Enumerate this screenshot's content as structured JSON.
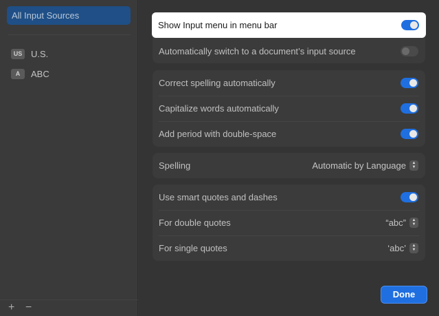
{
  "sidebar": {
    "selected_label": "All Input Sources",
    "sources": [
      {
        "badge": "US",
        "label": "U.S."
      },
      {
        "badge": "A",
        "label": "ABC"
      }
    ],
    "add_label": "+",
    "remove_label": "−"
  },
  "settings": {
    "show_input_menu": {
      "label": "Show Input menu in menu bar",
      "on": true
    },
    "auto_switch": {
      "label": "Automatically switch to a document’s input source",
      "on": false
    },
    "correct_spelling": {
      "label": "Correct spelling automatically",
      "on": true
    },
    "capitalize": {
      "label": "Capitalize words automatically",
      "on": true
    },
    "add_period": {
      "label": "Add period with double-space",
      "on": true
    },
    "spelling": {
      "label": "Spelling",
      "value": "Automatic by Language"
    },
    "smart_quotes": {
      "label": "Use smart quotes and dashes",
      "on": true
    },
    "double_quotes": {
      "label": "For double quotes",
      "value": "“abc”"
    },
    "single_quotes": {
      "label": "For single quotes",
      "value": "‘abc’"
    }
  },
  "footer": {
    "done_label": "Done"
  },
  "colors": {
    "accent": "#1f6fe0",
    "sidebar_selection": "#1f4f86"
  },
  "icons": {
    "toggle_on": "toggle-on-icon",
    "toggle_off": "toggle-off-icon",
    "stepper": "up-down-chevron-icon"
  }
}
